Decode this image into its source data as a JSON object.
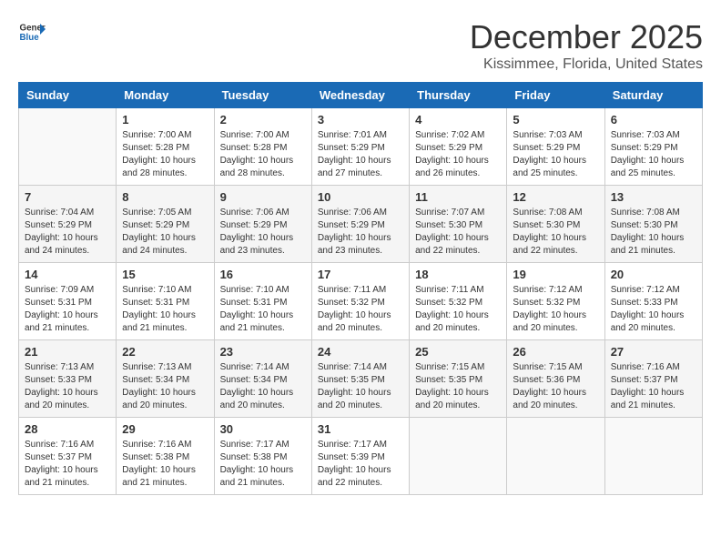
{
  "header": {
    "logo_general": "General",
    "logo_blue": "Blue",
    "month_title": "December 2025",
    "location": "Kissimmee, Florida, United States"
  },
  "days_of_week": [
    "Sunday",
    "Monday",
    "Tuesday",
    "Wednesday",
    "Thursday",
    "Friday",
    "Saturday"
  ],
  "weeks": [
    [
      {
        "day": "",
        "info": ""
      },
      {
        "day": "1",
        "info": "Sunrise: 7:00 AM\nSunset: 5:28 PM\nDaylight: 10 hours\nand 28 minutes."
      },
      {
        "day": "2",
        "info": "Sunrise: 7:00 AM\nSunset: 5:28 PM\nDaylight: 10 hours\nand 28 minutes."
      },
      {
        "day": "3",
        "info": "Sunrise: 7:01 AM\nSunset: 5:29 PM\nDaylight: 10 hours\nand 27 minutes."
      },
      {
        "day": "4",
        "info": "Sunrise: 7:02 AM\nSunset: 5:29 PM\nDaylight: 10 hours\nand 26 minutes."
      },
      {
        "day": "5",
        "info": "Sunrise: 7:03 AM\nSunset: 5:29 PM\nDaylight: 10 hours\nand 25 minutes."
      },
      {
        "day": "6",
        "info": "Sunrise: 7:03 AM\nSunset: 5:29 PM\nDaylight: 10 hours\nand 25 minutes."
      }
    ],
    [
      {
        "day": "7",
        "info": "Sunrise: 7:04 AM\nSunset: 5:29 PM\nDaylight: 10 hours\nand 24 minutes."
      },
      {
        "day": "8",
        "info": "Sunrise: 7:05 AM\nSunset: 5:29 PM\nDaylight: 10 hours\nand 24 minutes."
      },
      {
        "day": "9",
        "info": "Sunrise: 7:06 AM\nSunset: 5:29 PM\nDaylight: 10 hours\nand 23 minutes."
      },
      {
        "day": "10",
        "info": "Sunrise: 7:06 AM\nSunset: 5:29 PM\nDaylight: 10 hours\nand 23 minutes."
      },
      {
        "day": "11",
        "info": "Sunrise: 7:07 AM\nSunset: 5:30 PM\nDaylight: 10 hours\nand 22 minutes."
      },
      {
        "day": "12",
        "info": "Sunrise: 7:08 AM\nSunset: 5:30 PM\nDaylight: 10 hours\nand 22 minutes."
      },
      {
        "day": "13",
        "info": "Sunrise: 7:08 AM\nSunset: 5:30 PM\nDaylight: 10 hours\nand 21 minutes."
      }
    ],
    [
      {
        "day": "14",
        "info": "Sunrise: 7:09 AM\nSunset: 5:31 PM\nDaylight: 10 hours\nand 21 minutes."
      },
      {
        "day": "15",
        "info": "Sunrise: 7:10 AM\nSunset: 5:31 PM\nDaylight: 10 hours\nand 21 minutes."
      },
      {
        "day": "16",
        "info": "Sunrise: 7:10 AM\nSunset: 5:31 PM\nDaylight: 10 hours\nand 21 minutes."
      },
      {
        "day": "17",
        "info": "Sunrise: 7:11 AM\nSunset: 5:32 PM\nDaylight: 10 hours\nand 20 minutes."
      },
      {
        "day": "18",
        "info": "Sunrise: 7:11 AM\nSunset: 5:32 PM\nDaylight: 10 hours\nand 20 minutes."
      },
      {
        "day": "19",
        "info": "Sunrise: 7:12 AM\nSunset: 5:32 PM\nDaylight: 10 hours\nand 20 minutes."
      },
      {
        "day": "20",
        "info": "Sunrise: 7:12 AM\nSunset: 5:33 PM\nDaylight: 10 hours\nand 20 minutes."
      }
    ],
    [
      {
        "day": "21",
        "info": "Sunrise: 7:13 AM\nSunset: 5:33 PM\nDaylight: 10 hours\nand 20 minutes."
      },
      {
        "day": "22",
        "info": "Sunrise: 7:13 AM\nSunset: 5:34 PM\nDaylight: 10 hours\nand 20 minutes."
      },
      {
        "day": "23",
        "info": "Sunrise: 7:14 AM\nSunset: 5:34 PM\nDaylight: 10 hours\nand 20 minutes."
      },
      {
        "day": "24",
        "info": "Sunrise: 7:14 AM\nSunset: 5:35 PM\nDaylight: 10 hours\nand 20 minutes."
      },
      {
        "day": "25",
        "info": "Sunrise: 7:15 AM\nSunset: 5:35 PM\nDaylight: 10 hours\nand 20 minutes."
      },
      {
        "day": "26",
        "info": "Sunrise: 7:15 AM\nSunset: 5:36 PM\nDaylight: 10 hours\nand 20 minutes."
      },
      {
        "day": "27",
        "info": "Sunrise: 7:16 AM\nSunset: 5:37 PM\nDaylight: 10 hours\nand 21 minutes."
      }
    ],
    [
      {
        "day": "28",
        "info": "Sunrise: 7:16 AM\nSunset: 5:37 PM\nDaylight: 10 hours\nand 21 minutes."
      },
      {
        "day": "29",
        "info": "Sunrise: 7:16 AM\nSunset: 5:38 PM\nDaylight: 10 hours\nand 21 minutes."
      },
      {
        "day": "30",
        "info": "Sunrise: 7:17 AM\nSunset: 5:38 PM\nDaylight: 10 hours\nand 21 minutes."
      },
      {
        "day": "31",
        "info": "Sunrise: 7:17 AM\nSunset: 5:39 PM\nDaylight: 10 hours\nand 22 minutes."
      },
      {
        "day": "",
        "info": ""
      },
      {
        "day": "",
        "info": ""
      },
      {
        "day": "",
        "info": ""
      }
    ]
  ]
}
